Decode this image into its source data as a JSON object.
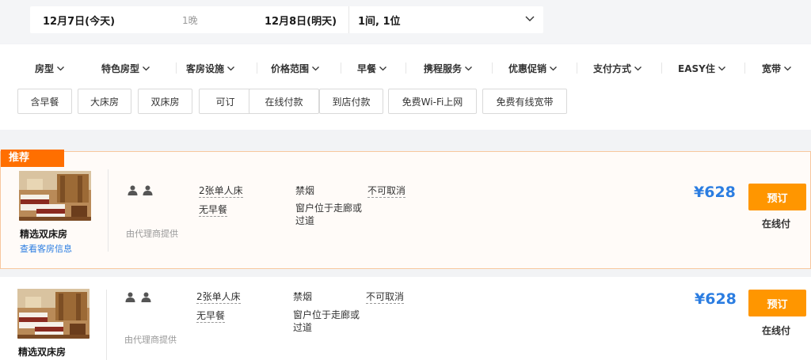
{
  "search": {
    "checkin": "12月7日(今天)",
    "nights": "1晚",
    "checkout": "12月8日(明天)",
    "guests": "1间, 1位"
  },
  "filters": [
    {
      "label": "房型"
    },
    {
      "label": "特色房型"
    },
    {
      "label": "客房设施"
    },
    {
      "label": "价格范围"
    },
    {
      "label": "早餐"
    },
    {
      "label": "携程服务"
    },
    {
      "label": "优惠促销"
    },
    {
      "label": "支付方式"
    },
    {
      "label": "EASY住"
    },
    {
      "label": "宽带"
    }
  ],
  "tags": [
    "含早餐",
    "大床房",
    "双床房",
    "可订",
    "在线付款",
    "到店付款",
    "免费Wi-Fi上网",
    "免费有线宽带"
  ],
  "rooms": [
    {
      "badge": "推荐",
      "name": "精选双床房",
      "info_link": "查看客房信息",
      "agent": "由代理商提供",
      "bed": "2张单人床",
      "meal": "无早餐",
      "smoking": "禁烟",
      "window": "窗户位于走廊或过道",
      "cancel": "不可取消",
      "price": "¥628",
      "book_label": "预订",
      "pay_type": "在线付"
    },
    {
      "name": "精选双床房",
      "agent": "由代理商提供",
      "bed": "2张单人床",
      "meal": "无早餐",
      "smoking": "禁烟",
      "window": "窗户位于走廊或过道",
      "cancel": "不可取消",
      "price": "¥628",
      "book_label": "预订",
      "pay_type": "在线付"
    }
  ],
  "colors": {
    "accent_orange": "#ff9600",
    "badge_orange": "#ff6f00",
    "price_blue": "#2b7de1"
  }
}
